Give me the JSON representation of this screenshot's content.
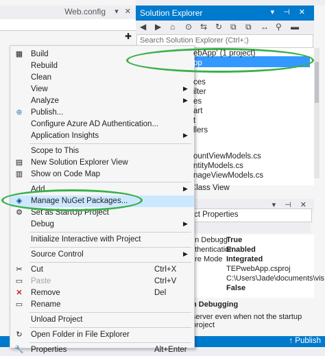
{
  "editor": {
    "tab_title": "Web.config",
    "tab_icons": "▾ ✕"
  },
  "solution_explorer": {
    "title": "Solution Explorer",
    "title_icons": "▾ ⊣ ✕",
    "toolbar_icons": [
      "◀",
      "▶",
      "⌂",
      "⊙",
      "⇆",
      "↻",
      "⧉",
      "⧉",
      "↔",
      "⚲",
      "▬"
    ],
    "search_placeholder": "Search Solution Explorer (Ctrl+;)",
    "tree_items": [
      "ebApp' (1 project)",
      "pp",
      "ces",
      "ilter",
      "es",
      "art",
      "t",
      "llers",
      "ountViewModels.cs",
      "ntityModels.cs",
      "nageViewModels.cs"
    ],
    "class_view": "Class View"
  },
  "properties": {
    "title_icons": "▾ ⊣ ✕",
    "header": "ct Properties",
    "rows": [
      {
        "name": "en Debuggi",
        "value": "True",
        "bold": true
      },
      {
        "name": "uthentication",
        "value": "Enabled",
        "bold": true
      },
      {
        "name": "ure Mode",
        "value": "Integrated",
        "bold": true
      },
      {
        "name": "",
        "value": "TEPwebApp.csproj",
        "bold": false
      },
      {
        "name": "",
        "value": "C:\\Users\\Jade\\documents\\vis",
        "bold": false
      },
      {
        "name": "",
        "value": "False",
        "bold": true
      }
    ],
    "desc_title": "n Debugging",
    "desc_text": "server even when not the startup project"
  },
  "status_bar": {
    "publish": "↑ Publish"
  },
  "context_menu": {
    "items": [
      {
        "label": "Build",
        "icon": "build-icon",
        "glyph": "▦",
        "shortcut": "",
        "submenu": false,
        "disabled": false
      },
      {
        "label": "Rebuild",
        "icon": "",
        "glyph": "",
        "shortcut": "",
        "submenu": false,
        "disabled": false
      },
      {
        "label": "Clean",
        "icon": "",
        "glyph": "",
        "shortcut": "",
        "submenu": false,
        "disabled": false
      },
      {
        "label": "View",
        "icon": "",
        "glyph": "",
        "shortcut": "",
        "submenu": true,
        "disabled": false
      },
      {
        "label": "Analyze",
        "icon": "",
        "glyph": "",
        "shortcut": "",
        "submenu": true,
        "disabled": false
      },
      {
        "label": "Publish...",
        "icon": "globe-icon",
        "glyph": "⊕",
        "shortcut": "",
        "submenu": false,
        "disabled": false
      },
      {
        "label": "Configure Azure AD Authentication...",
        "icon": "",
        "glyph": "",
        "shortcut": "",
        "submenu": false,
        "disabled": false
      },
      {
        "label": "Application Insights",
        "icon": "",
        "glyph": "",
        "shortcut": "",
        "submenu": true,
        "disabled": false
      },
      {
        "sep": true
      },
      {
        "label": "Scope to This",
        "icon": "",
        "glyph": "",
        "shortcut": "",
        "submenu": false,
        "disabled": false
      },
      {
        "label": "New Solution Explorer View",
        "icon": "new-view-icon",
        "glyph": "▤",
        "shortcut": "",
        "submenu": false,
        "disabled": false
      },
      {
        "label": "Show on Code Map",
        "icon": "code-map-icon",
        "glyph": "▥",
        "shortcut": "",
        "submenu": false,
        "disabled": false
      },
      {
        "sep": true
      },
      {
        "label": "Add",
        "icon": "",
        "glyph": "",
        "shortcut": "",
        "submenu": true,
        "disabled": false
      },
      {
        "label": "Manage NuGet Packages...",
        "icon": "nuget-icon",
        "glyph": "◈",
        "shortcut": "",
        "submenu": false,
        "disabled": false,
        "highlight": true
      },
      {
        "label": "Set as StartUp Project",
        "icon": "settings-icon",
        "glyph": "⚙",
        "shortcut": "",
        "submenu": false,
        "disabled": false
      },
      {
        "label": "Debug",
        "icon": "",
        "glyph": "",
        "shortcut": "",
        "submenu": true,
        "disabled": false
      },
      {
        "sep": true
      },
      {
        "label": "Initialize Interactive with Project",
        "icon": "",
        "glyph": "",
        "shortcut": "",
        "submenu": false,
        "disabled": false
      },
      {
        "sep": true
      },
      {
        "label": "Source Control",
        "icon": "",
        "glyph": "",
        "shortcut": "",
        "submenu": true,
        "disabled": false
      },
      {
        "sep": true
      },
      {
        "label": "Cut",
        "icon": "cut-icon",
        "glyph": "✂",
        "shortcut": "Ctrl+X",
        "submenu": false,
        "disabled": false
      },
      {
        "label": "Paste",
        "icon": "paste-icon",
        "glyph": "▭",
        "shortcut": "Ctrl+V",
        "submenu": false,
        "disabled": true
      },
      {
        "label": "Remove",
        "icon": "remove-icon",
        "glyph": "✕",
        "shortcut": "Del",
        "submenu": false,
        "disabled": false
      },
      {
        "label": "Rename",
        "icon": "rename-icon",
        "glyph": "▭",
        "shortcut": "",
        "submenu": false,
        "disabled": false
      },
      {
        "sep": true
      },
      {
        "label": "Unload Project",
        "icon": "",
        "glyph": "",
        "shortcut": "",
        "submenu": false,
        "disabled": false
      },
      {
        "sep": true
      },
      {
        "label": "Open Folder in File Explorer",
        "icon": "folder-refresh-icon",
        "glyph": "↻",
        "shortcut": "",
        "submenu": false,
        "disabled": false
      },
      {
        "sep": true
      },
      {
        "label": "Properties",
        "icon": "wrench-icon",
        "glyph": "🔧",
        "shortcut": "Alt+Enter",
        "submenu": false,
        "disabled": false
      }
    ]
  },
  "colors": {
    "accent": "#007acc",
    "selection": "#3399ff",
    "menu_highlight": "#cce8ff",
    "annotation_green": "#3ab04a",
    "remove_red": "#c4271c"
  }
}
